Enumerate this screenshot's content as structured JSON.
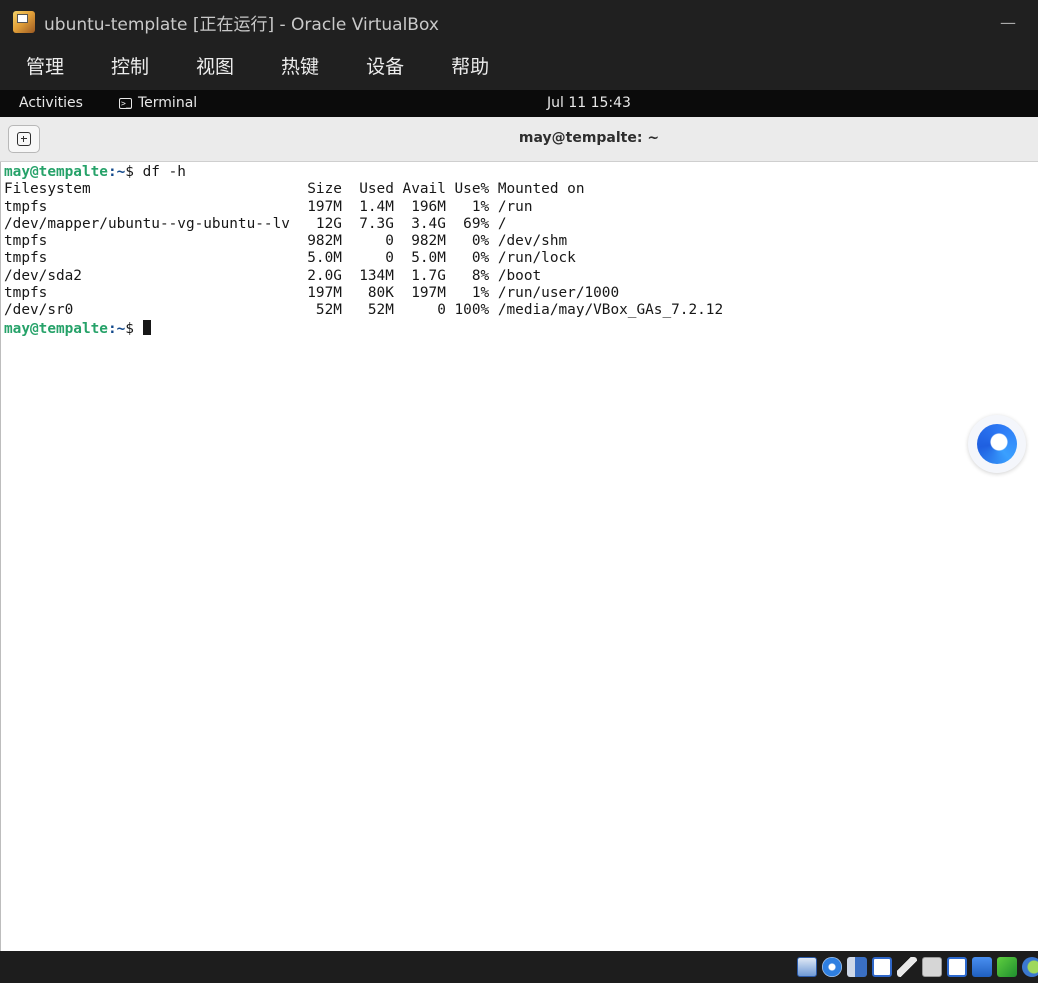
{
  "window": {
    "title": "ubuntu-template [正在运行] - Oracle VirtualBox",
    "minimize_glyph": "—"
  },
  "menubar": {
    "items": [
      {
        "label": "管理"
      },
      {
        "label": "控制"
      },
      {
        "label": "视图"
      },
      {
        "label": "热键"
      },
      {
        "label": "设备"
      },
      {
        "label": "帮助"
      }
    ]
  },
  "gnome_topbar": {
    "activities": "Activities",
    "app_name": "Terminal",
    "app_icon": "terminal-icon",
    "clock": "Jul 11  15:43"
  },
  "terminal": {
    "title": "may@tempalte: ~",
    "new_tab_icon": "new-tab-icon",
    "prompt_user": "may@tempalte",
    "prompt_path": ":~",
    "prompt_symbol": "$ ",
    "command": "df -h",
    "output_lines": [
      "Filesystem                         Size  Used Avail Use% Mounted on",
      "tmpfs                              197M  1.4M  196M   1% /run",
      "/dev/mapper/ubuntu--vg-ubuntu--lv   12G  7.3G  3.4G  69% /",
      "tmpfs                              982M     0  982M   0% /dev/shm",
      "tmpfs                              5.0M     0  5.0M   0% /run/lock",
      "/dev/sda2                          2.0G  134M  1.7G   8% /boot",
      "tmpfs                              197M   80K  197M   1% /run/user/1000",
      "/dev/sr0                            52M   52M     0 100% /media/may/VBox_GAs_7.2.12"
    ]
  },
  "floating_button": {
    "icon": "assistant-bubble-icon"
  },
  "statusbar": {
    "icons": [
      "hard-disk-icon",
      "optical-drive-icon",
      "audio-icon",
      "network-icon",
      "usb-icon",
      "shared-folder-icon",
      "display-icon",
      "recording-icon",
      "cpu-icon",
      "host-key-icon"
    ]
  }
}
